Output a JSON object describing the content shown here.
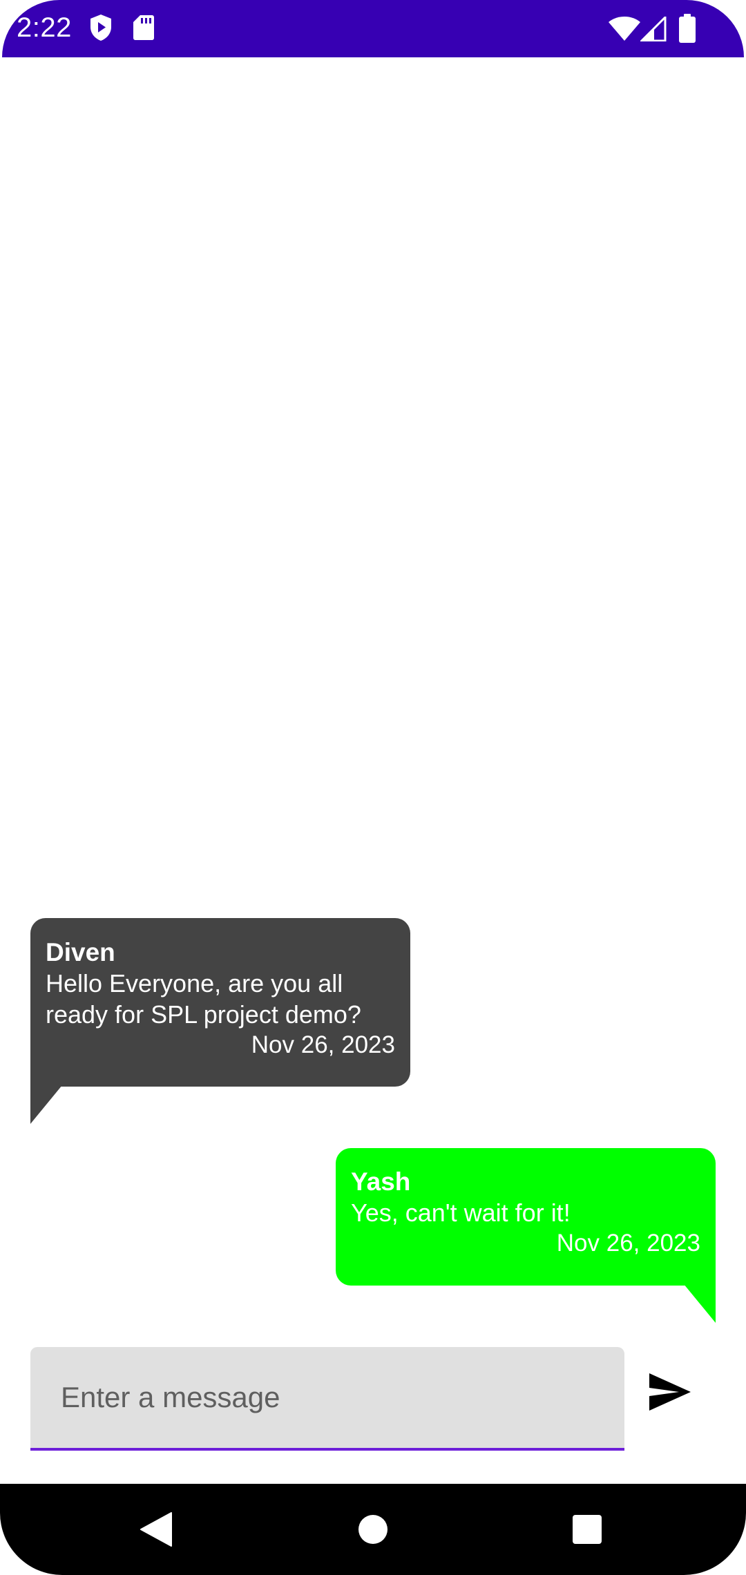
{
  "status_bar": {
    "time": "2:22",
    "left_icons": [
      "shield-play-icon",
      "sd-card-icon"
    ],
    "right_icons": [
      "wifi-icon",
      "signal-icon",
      "battery-icon"
    ],
    "background_color": "#3700b3"
  },
  "messages": [
    {
      "sender": "Diven",
      "text_lines": [
        "Hello Everyone, are you all",
        "ready for SPL project demo?"
      ],
      "date": "Nov 26, 2023",
      "direction": "incoming",
      "bubble_color": "#444444"
    },
    {
      "sender": "Yash",
      "text_lines": [
        "Yes, can't wait for it!"
      ],
      "date": "Nov 26, 2023",
      "direction": "outgoing",
      "bubble_color": "#00ff00"
    }
  ],
  "composer": {
    "placeholder": "Enter a message",
    "value": "",
    "send_icon": "send-icon",
    "underline_color": "#6d1fd9"
  },
  "nav_bar": {
    "buttons": [
      "back-icon",
      "home-icon",
      "recents-icon"
    ]
  }
}
